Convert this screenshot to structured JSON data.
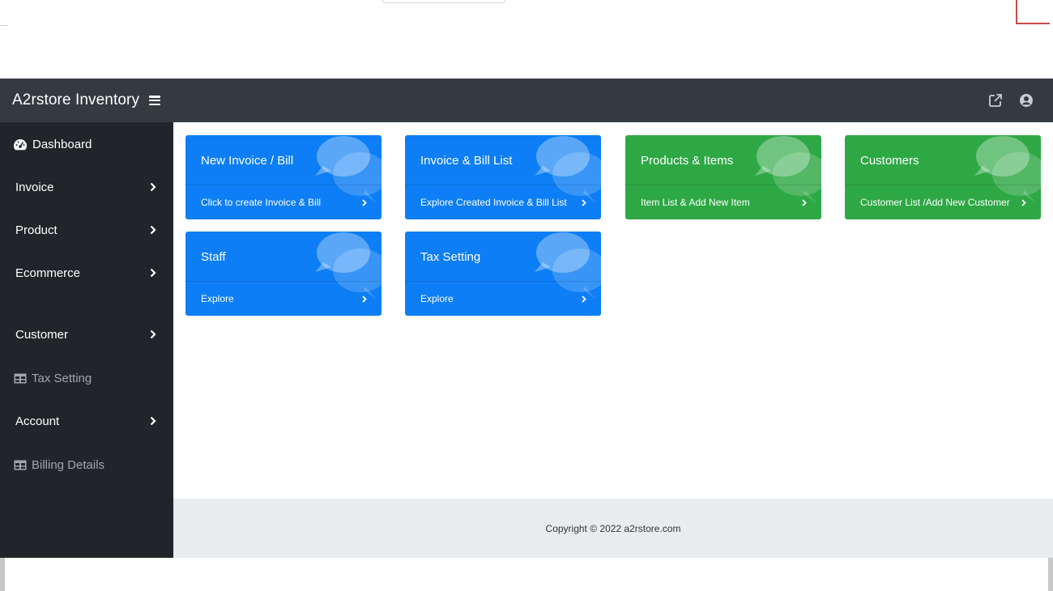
{
  "app": {
    "brand": "A2rstore Inventory"
  },
  "colors": {
    "navbar": "#343a40",
    "sidebar": "#212529",
    "card_blue": "#0d7ef5",
    "card_green": "#2ea845",
    "footer_bg": "#e9ecef"
  },
  "navbar": {
    "icons": [
      "external-link-icon",
      "user-circle-icon"
    ]
  },
  "sidebar": {
    "items": [
      {
        "label": "Dashboard",
        "icon": "dashboard-gauge-icon"
      },
      {
        "label": "Invoice",
        "icon": "chevron-right-icon"
      },
      {
        "label": "Product",
        "icon": "chevron-right-icon"
      },
      {
        "label": "Ecommerce",
        "icon": "chevron-right-icon"
      },
      {
        "label": "Customer",
        "icon": "chevron-right-icon"
      },
      {
        "label": "Tax Setting",
        "icon": "table-icon"
      },
      {
        "label": "Account",
        "icon": "chevron-right-icon"
      },
      {
        "label": "Billing Details",
        "icon": "table-icon"
      }
    ]
  },
  "cards": [
    {
      "title": "New Invoice / Bill",
      "link": "Click to create Invoice & Bill",
      "color": "blue",
      "icon": "comments-icon"
    },
    {
      "title": "Invoice & Bill List",
      "link": "Explore Created Invoice & Bill List",
      "color": "blue",
      "icon": "comments-icon"
    },
    {
      "title": "Products & Items",
      "link": "Item List & Add New Item",
      "color": "green",
      "icon": "comments-icon"
    },
    {
      "title": "Customers",
      "link": "Customer List /Add New Customer",
      "color": "green",
      "icon": "comments-icon"
    },
    {
      "title": "Staff",
      "link": "Explore",
      "color": "blue",
      "icon": "comments-icon"
    },
    {
      "title": "Tax Setting",
      "link": "Explore",
      "color": "blue",
      "icon": "comments-icon"
    }
  ],
  "footer": {
    "copyright": "Copyright © 2022 a2rstore.com"
  }
}
